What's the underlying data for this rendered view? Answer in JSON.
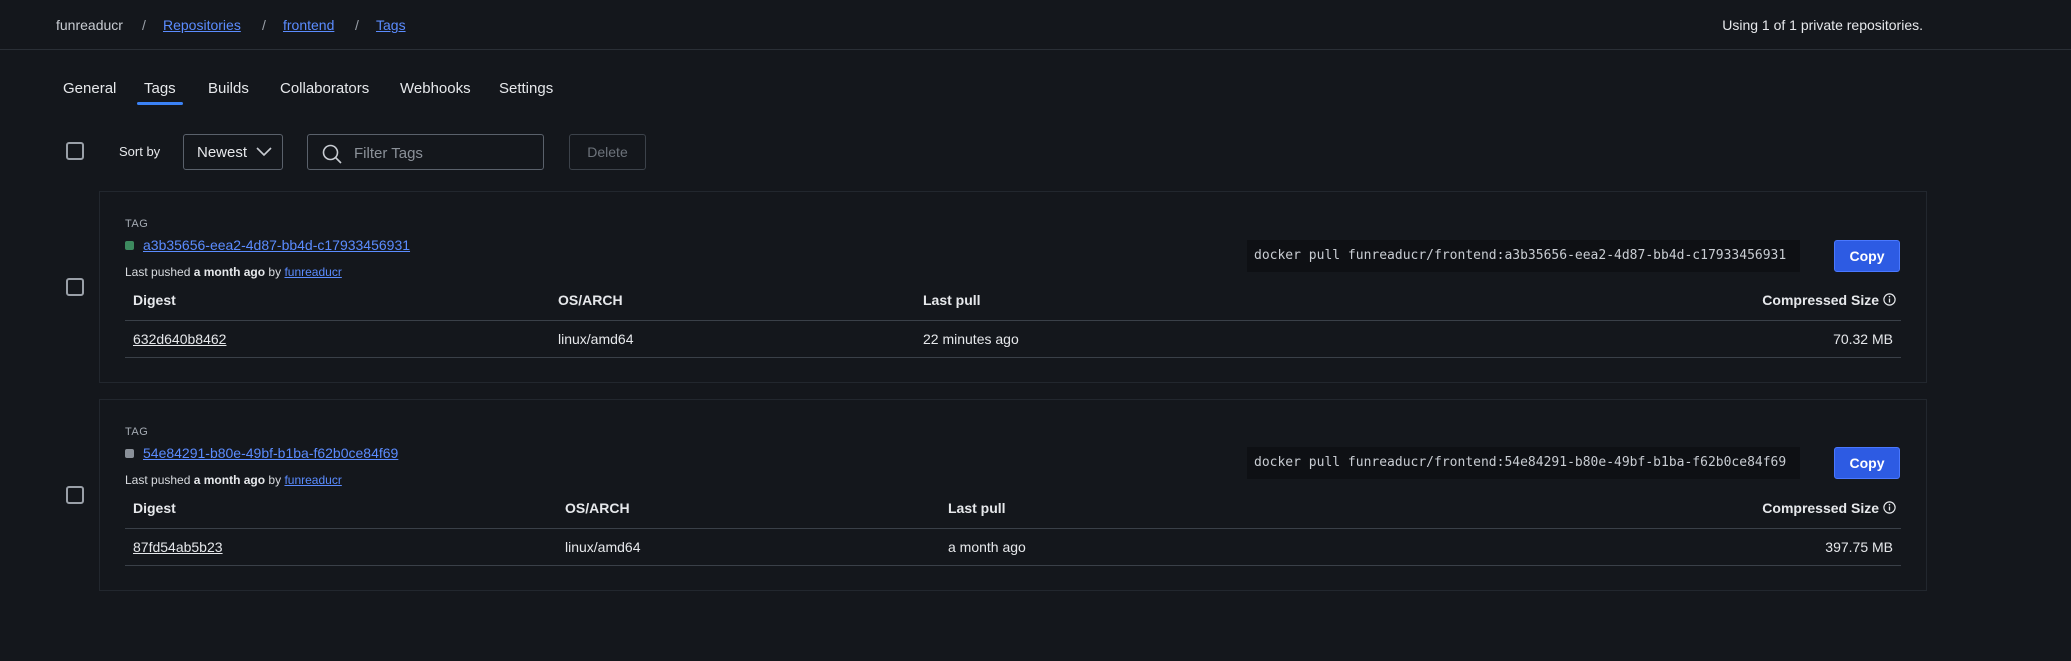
{
  "breadcrumb": {
    "org": "funreaducr",
    "repositories": "Repositories",
    "repo": "frontend",
    "current": "Tags",
    "separator": "/"
  },
  "usage_text": "Using 1 of 1 private repositories.",
  "tabs": [
    {
      "label": "General"
    },
    {
      "label": "Tags",
      "active": true
    },
    {
      "label": "Builds"
    },
    {
      "label": "Collaborators"
    },
    {
      "label": "Webhooks"
    },
    {
      "label": "Settings"
    }
  ],
  "toolbar": {
    "sort_label": "Sort by",
    "sort_value": "Newest",
    "filter_placeholder": "Filter Tags",
    "delete_label": "Delete"
  },
  "columns": {
    "digest": "Digest",
    "os_arch": "OS/ARCH",
    "last_pull": "Last pull",
    "size": "Compressed Size"
  },
  "tags": [
    {
      "label": "TAG",
      "name": "a3b35656-eea2-4d87-bb4d-c17933456931",
      "dot_color": "#3d8a5f",
      "pushed_prefix": "Last pushed",
      "pushed_when": "a month ago",
      "pushed_by_word": "by",
      "pushed_by": "funreaducr",
      "pull_command": "docker pull funreaducr/frontend:a3b35656-eea2-4d87-bb4d-c17933456931",
      "copy_label": "Copy",
      "row": {
        "digest": "632d640b8462",
        "os_arch": "linux/amd64",
        "last_pull": "22 minutes ago",
        "size": "70.32 MB"
      }
    },
    {
      "label": "TAG",
      "name": "54e84291-b80e-49bf-b1ba-f62b0ce84f69",
      "dot_color": "#8a9099",
      "pushed_prefix": "Last pushed",
      "pushed_when": "a month ago",
      "pushed_by_word": "by",
      "pushed_by": "funreaducr",
      "pull_command": "docker pull funreaducr/frontend:54e84291-b80e-49bf-b1ba-f62b0ce84f69",
      "copy_label": "Copy",
      "row": {
        "digest": "87fd54ab5b23",
        "os_arch": "linux/amd64",
        "last_pull": "a month ago",
        "size": "397.75 MB"
      }
    }
  ]
}
